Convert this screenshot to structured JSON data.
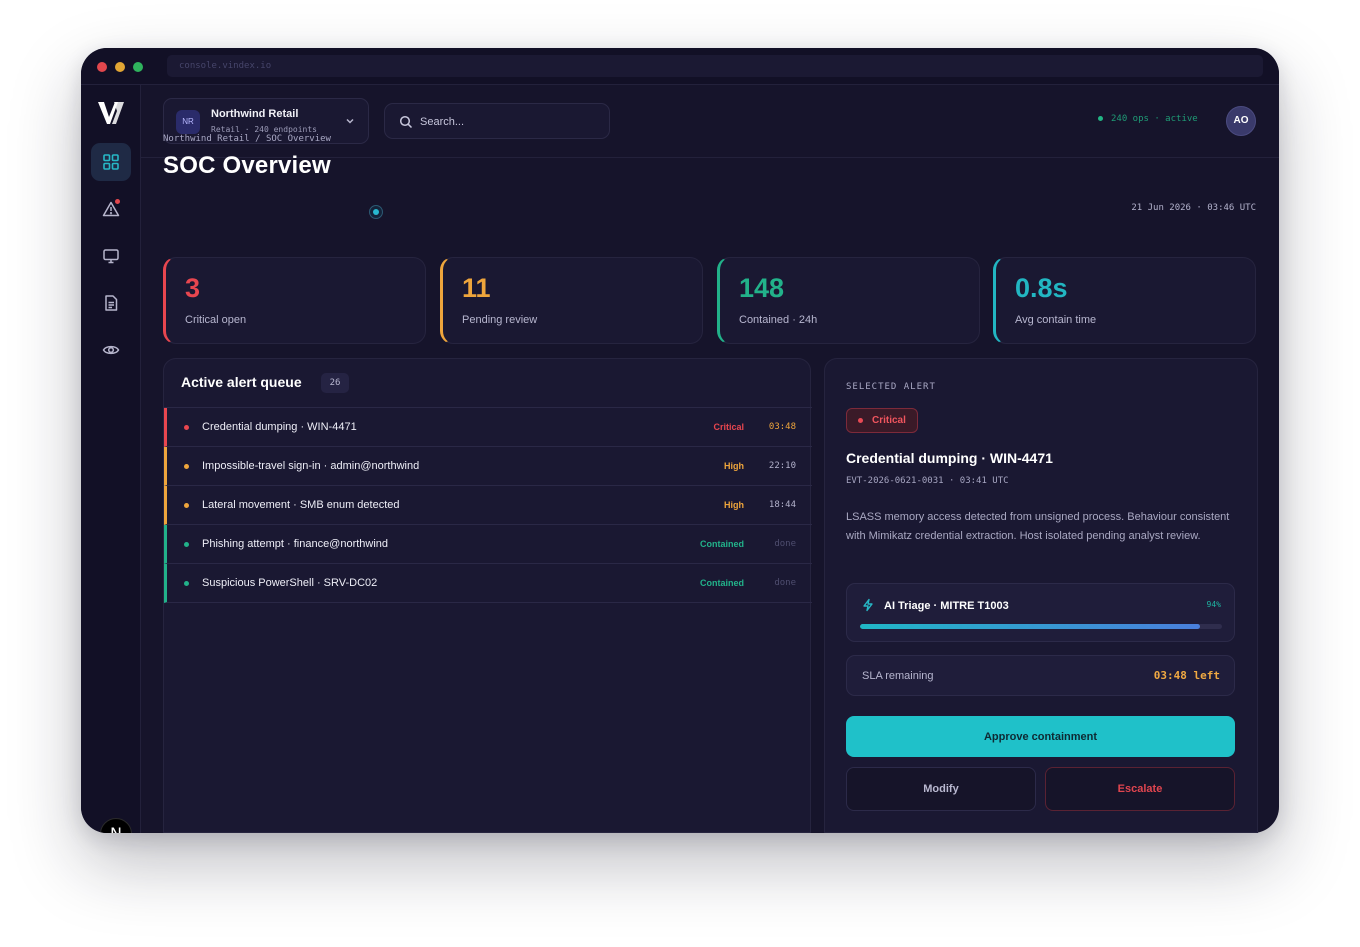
{
  "url": "console.vindex.io",
  "org": {
    "initials": "NR",
    "name": "Northwind Retail",
    "subtitle": "Retail · 240 endpoints"
  },
  "search": {
    "placeholder": "Search..."
  },
  "status": {
    "text": "240 ops · active",
    "color": "#22b584"
  },
  "user": {
    "initials": "AO"
  },
  "nav": {
    "items": [
      {
        "name": "grid-icon",
        "active": true
      },
      {
        "name": "alert-triangle-icon",
        "badge": true
      },
      {
        "name": "monitor-icon"
      },
      {
        "name": "document-icon"
      },
      {
        "name": "eye-icon"
      }
    ]
  },
  "page": {
    "breadcrumb": "Northwind Retail / SOC Overview",
    "title": "SOC Overview",
    "datetime": "21 Jun 2026 · 03:46 UTC"
  },
  "stats": [
    {
      "value": "3",
      "label": "Critical open",
      "color": "#e8464f"
    },
    {
      "value": "11",
      "label": "Pending review",
      "color": "#eea53c"
    },
    {
      "value": "148",
      "label": "Contained · 24h",
      "color": "#22b28a"
    },
    {
      "value": "0.8s",
      "label": "Avg contain time",
      "color": "#22b6c2"
    }
  ],
  "queue": {
    "title": "Active alert queue",
    "count": "26",
    "rows": [
      {
        "title": "Credential dumping · WIN-4471",
        "severity": "Critical",
        "time": "03:48",
        "color": "#e8464f",
        "time_color": "#eea53c"
      },
      {
        "title": "Impossible-travel sign-in · admin@northwind",
        "severity": "High",
        "time": "22:10",
        "color": "#eea53c",
        "time_color": "#b3b2cc"
      },
      {
        "title": "Lateral movement · SMB enum detected",
        "severity": "High",
        "time": "18:44",
        "color": "#eea53c",
        "time_color": "#b3b2cc"
      },
      {
        "title": "Phishing attempt · finance@northwind",
        "severity": "Contained",
        "time": "done",
        "color": "#22b28a",
        "time_color": "#4e4d6e"
      },
      {
        "title": "Suspicious PowerShell · SRV-DC02",
        "severity": "Contained",
        "time": "done",
        "color": "#22b28a",
        "time_color": "#4e4d6e"
      }
    ]
  },
  "selected": {
    "eyebrow": "SELECTED ALERT",
    "severity": "Critical",
    "title": "Credential dumping · WIN-4471",
    "event_id": "EVT-2026-0621-0031 · 03:41 UTC",
    "description": "LSASS memory access detected from unsigned process. Behaviour consistent with Mimikatz credential extraction. Host isolated pending analyst review.",
    "triage": {
      "label": "AI Triage · MITRE T1003",
      "percent_text": "94%",
      "confidence": 0.94
    },
    "sla": {
      "label": "SLA remaining",
      "value": "03:48 left"
    },
    "actions": {
      "approve": "Approve containment",
      "modify": "Modify",
      "escalate": "Escalate"
    }
  }
}
